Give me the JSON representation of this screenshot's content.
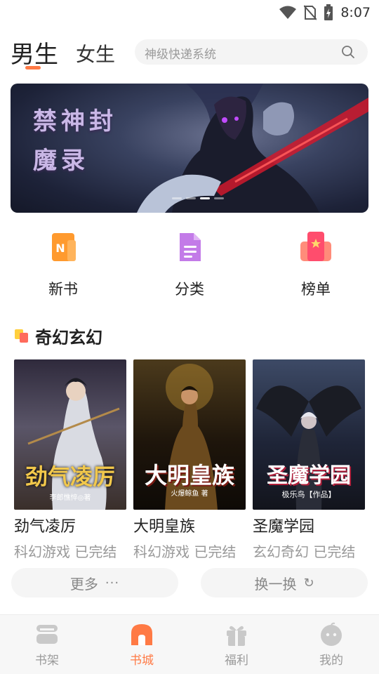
{
  "status": {
    "time": "8:07"
  },
  "header": {
    "tab_male": "男生",
    "tab_female": "女生",
    "search_placeholder": "神级快递系统"
  },
  "banner": {
    "title_line1": "禁神封",
    "title_line2": "魔录",
    "dot_count": 4,
    "active_dot": 2
  },
  "shortcuts": [
    {
      "label": "新书",
      "icon": "new-book-icon",
      "glyph": "N"
    },
    {
      "label": "分类",
      "icon": "category-icon"
    },
    {
      "label": "榜单",
      "icon": "ranking-icon"
    }
  ],
  "section": {
    "title": "奇幻玄幻"
  },
  "books": [
    {
      "title": "劲气凌厉",
      "meta": "科幻游戏 已完结",
      "cover_title": "劲气凌厉",
      "cover_author": "李郎憔悴◎著"
    },
    {
      "title": "大明皇族",
      "meta": "科幻游戏 已完结",
      "cover_title": "大明皇族",
      "cover_author": "火爆鲸鱼 著"
    },
    {
      "title": "圣魔学园",
      "meta": "玄幻奇幻 已完结",
      "cover_title": "圣魔学园",
      "cover_author": "极乐鸟【作品】"
    }
  ],
  "actions": {
    "more": "更多",
    "more_glyph": "···",
    "refresh": "换一换",
    "refresh_glyph": "↻"
  },
  "bottom_nav": [
    {
      "label": "书架",
      "icon": "bookshelf-icon"
    },
    {
      "label": "书城",
      "icon": "bookstore-icon"
    },
    {
      "label": "福利",
      "icon": "gift-icon"
    },
    {
      "label": "我的",
      "icon": "profile-icon"
    }
  ],
  "colors": {
    "accent": "#ff7a45",
    "gray_text": "#999999"
  }
}
